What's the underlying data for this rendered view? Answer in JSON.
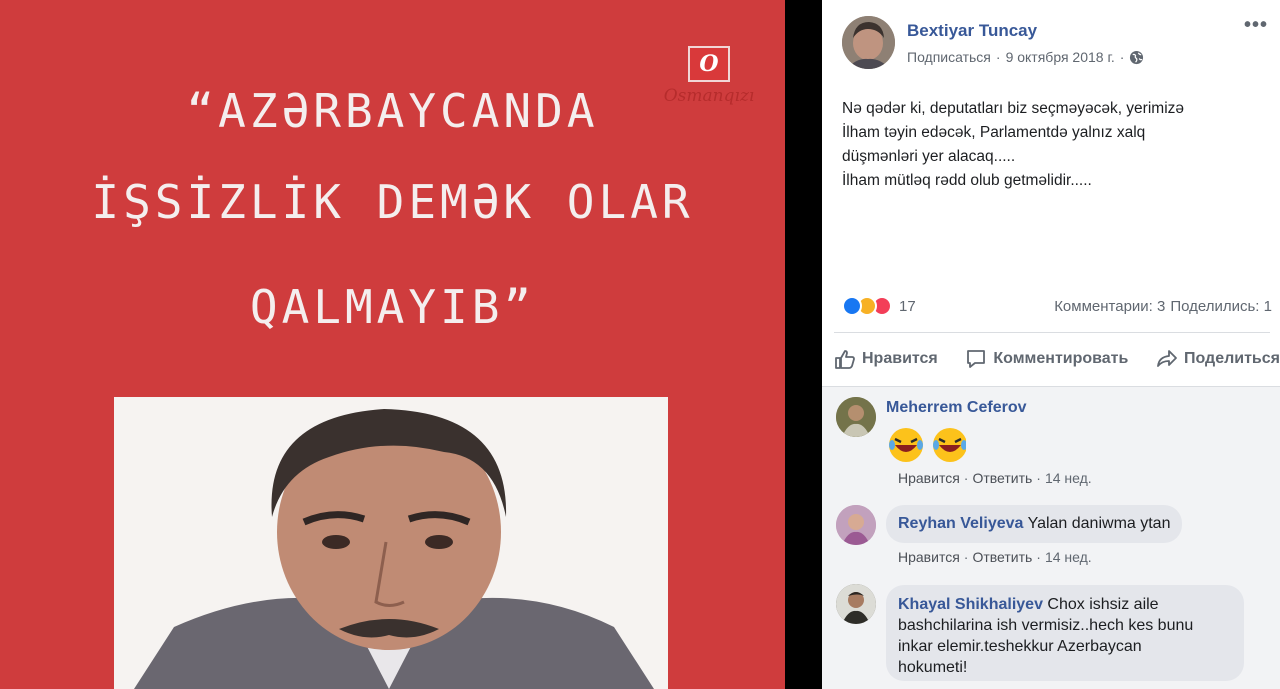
{
  "image": {
    "quote_lines": [
      "“AZƏRBAYCANDA",
      "İŞSİZLİK DEMƏK OLAR",
      "QALMAYIB”"
    ],
    "watermark_letter": "O",
    "watermark_text": "Osmanqızı"
  },
  "post": {
    "author": "Bextiyar Tuncay",
    "subscribe": "Подписаться",
    "separator": "·",
    "date": "9 октября 2018 г.",
    "separator2": "·",
    "more": "•••",
    "text_lines": [
      "Nə qədər ki, deputatları biz seçməyəcək, yerimizə",
      "İlham təyin edəcək, Parlamentdə yalnız xalq",
      "düşmənləri yer alacaq.....",
      "İlham mütləq rədd olub getməlidir....."
    ],
    "reaction_count": "17",
    "comments_count": "Комментарии: 3",
    "shares_count": "Поделились: 1",
    "actions": {
      "like": "Нравится",
      "comment": "Комментировать",
      "share": "Поделиться"
    }
  },
  "comments": [
    {
      "name": "Meherrem Ceferov",
      "text": "",
      "emoji": "😂😂",
      "like": "Нравится",
      "reply": "Ответить",
      "dot": "·",
      "time": "14 нед."
    },
    {
      "name": "Reyhan Veliyeva",
      "text": "Yalan daniwma ytan",
      "like": "Нравится",
      "reply": "Ответить",
      "dot": "·",
      "time": "14 нед."
    },
    {
      "name": "Khayal Shikhaliyev",
      "text_lines": [
        "Chox ishsiz aile",
        "bashchilarina ish vermisiz..hech kes bunu",
        "inkar elemir.teshekkur Azerbaycan",
        "hokumeti!"
      ]
    }
  ],
  "colors": {
    "panel_red": "#cf3c3d",
    "link_blue": "#385898",
    "like_blue": "#1877f2",
    "love_red": "#f33e58",
    "haha_yellow": "#f7b125"
  }
}
